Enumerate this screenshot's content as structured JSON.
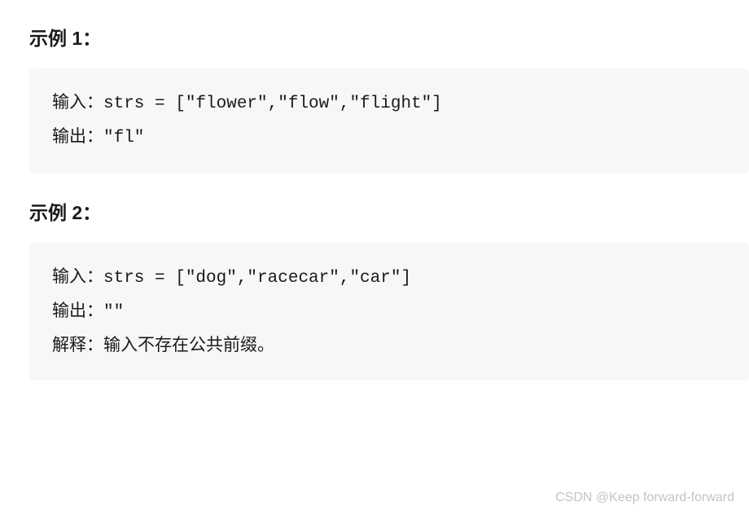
{
  "examples": [
    {
      "heading": "示例 1：",
      "input_label": "输入：",
      "input_code": "strs = [\"flower\",\"flow\",\"flight\"]",
      "output_label": "输出：",
      "output_code": "\"fl\"",
      "has_explanation": false
    },
    {
      "heading": "示例 2：",
      "input_label": "输入：",
      "input_code": "strs = [\"dog\",\"racecar\",\"car\"]",
      "output_label": "输出：",
      "output_code": "\"\"",
      "has_explanation": true,
      "explain_label": "解释：",
      "explain_text": "输入不存在公共前缀。"
    }
  ],
  "watermark": "CSDN @Keep forward-forward"
}
